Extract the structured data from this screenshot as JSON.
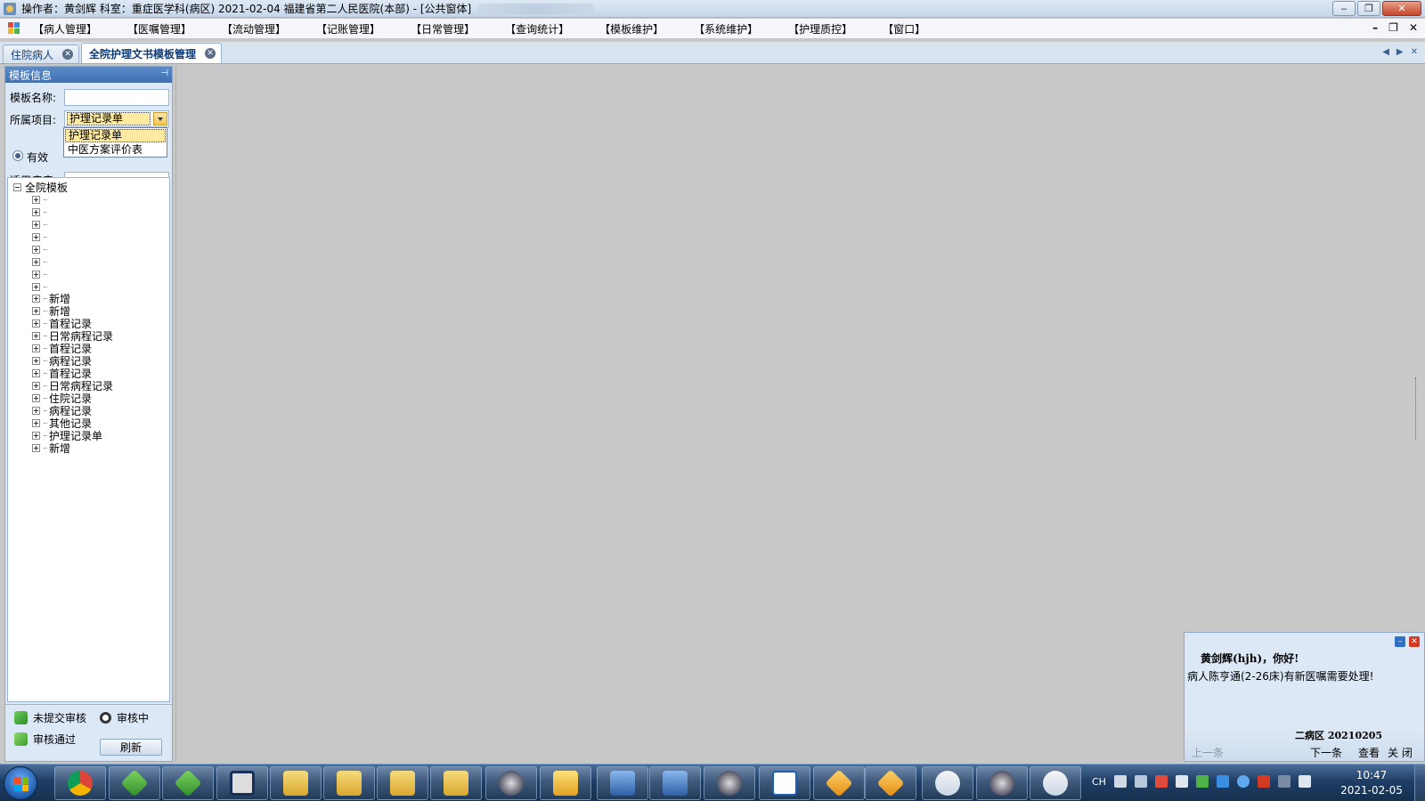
{
  "window": {
    "title": "操作者：黄剑辉  科室：重症医学科(病区)  2021-02-04  福建省第二人民医院(本部) - [公共窗体]",
    "controls": {
      "minimize": "‒",
      "restore": "❐",
      "close": "✕"
    }
  },
  "menu": {
    "items": [
      "【病人管理】",
      "【医嘱管理】",
      "【流动管理】",
      "【记账管理】",
      "【日常管理】",
      "【查询统计】",
      "【模板维护】",
      "【系统维护】",
      "【护理质控】",
      "【窗口】"
    ],
    "mdi_controls": {
      "minimize": "–",
      "restore": "❐",
      "close": "✕"
    }
  },
  "tabs": [
    {
      "label": "住院病人",
      "active": false
    },
    {
      "label": "全院护理文书模板管理",
      "active": true
    }
  ],
  "tab_nav": {
    "prev": "◀",
    "next": "▶",
    "close": "✕"
  },
  "left_panel": {
    "header": "模板信息",
    "pin": "⊣",
    "form": {
      "name_label": "模板名称:",
      "name_value": "",
      "project_label": "所属项目:",
      "project_value": "护理记录单",
      "valid_label": "有效",
      "disease_label": "适用疾病:",
      "disease_value": ""
    },
    "dropdown_options": [
      "护理记录单",
      "中医方案评价表"
    ],
    "tree": {
      "root": "全院模板",
      "children": [
        "",
        "",
        "",
        "",
        "",
        "",
        "",
        "",
        "新增",
        "新增",
        "首程记录",
        "日常病程记录",
        "首程记录",
        "病程记录",
        "首程记录",
        "日常病程记录",
        "住院记录",
        "病程记录",
        "其他记录",
        "护理记录单",
        "新增"
      ]
    },
    "actions": {
      "not_submitted": "未提交审核",
      "in_review": "审核中",
      "approved": "审核通过",
      "refresh": "刷新"
    }
  },
  "notification": {
    "greeting": "黄剑辉(hjh)，你好!",
    "message": "病人陈亨通(2-26床)有新医嘱需要处理!",
    "ward": "二病区  20210205",
    "prev": "上一条",
    "next": "下一条",
    "view": "查看",
    "close": "关 闭"
  },
  "taskbar": {
    "tray_lang": "CH",
    "time": "10:47",
    "date": "2021-02-05"
  },
  "colors": {
    "accent": "#3f6fae",
    "panel_bg": "#dce8f6",
    "main_bg": "#c8c8c8",
    "highlight": "#fde9a0"
  }
}
